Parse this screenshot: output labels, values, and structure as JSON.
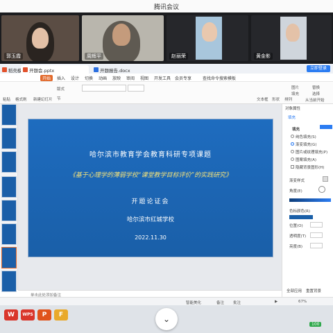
{
  "meeting": {
    "title": "腾讯会议",
    "participants": [
      {
        "name": "郭玉霞"
      },
      {
        "name": "周辉平"
      },
      {
        "name": "赵丽荣"
      },
      {
        "name": "黄金影"
      }
    ]
  },
  "wps": {
    "tabs": [
      {
        "label": "稻壳模板"
      },
      {
        "label": "开题会.pptx"
      },
      {
        "label": "开题报告.docx"
      }
    ],
    "login_label": "立即登录",
    "menu": [
      "开始",
      "插入",
      "设计",
      "切换",
      "动画",
      "放映",
      "审阅",
      "视图",
      "开发工具",
      "会员专享",
      "查找命令",
      "搜索模板"
    ],
    "active_menu": "开始",
    "ribbon": {
      "paste": "粘贴",
      "format_painter": "格式刷",
      "new_slide": "新建幻灯片",
      "layout": "版式",
      "section": "节",
      "textbox": "文本框",
      "shapes": "形状",
      "arrange": "排列",
      "picture": "图片",
      "fill": "填充",
      "play": "从当前开始",
      "replace": "替换",
      "select": "选择"
    },
    "slide": {
      "topic": "哈尔滨市教育学会教育科研专项课题",
      "title": "《基于心理学的薄弱学校“课堂教学目标评价”的实践研究》",
      "meeting": "开题论证会",
      "school": "哈尔滨市红城学校",
      "date": "2022.11.30"
    },
    "notes_placeholder": "单击此处添加备注",
    "panel": {
      "header": "对象属性",
      "tab": "填充",
      "section": "填充",
      "options": [
        "纯色填充(S)",
        "渐变填充(G)",
        "图片或纹理填充(P)",
        "图案填充(A)",
        "隐藏背景图形(H)"
      ],
      "selected_option": "渐变填充(G)",
      "gradient_style": "渐变样式",
      "angle": "角度(E)",
      "stop": "色标颜色(R)",
      "position": "位置(O)",
      "transparency": "透明度(T)",
      "brightness": "亮度(B)",
      "apply_all": "全部应用",
      "reset": "重置背景"
    },
    "status": {
      "smart_beautify": "智能美化",
      "notes": "备注",
      "comments": "批注",
      "zoom": "67%"
    }
  },
  "taskbar": {
    "apps": [
      "W",
      "WPS",
      "P",
      "F"
    ],
    "battery": "100",
    "colors": [
      "#d9362b",
      "#2b6fe0",
      "#e0531c",
      "#e9a92a"
    ]
  }
}
